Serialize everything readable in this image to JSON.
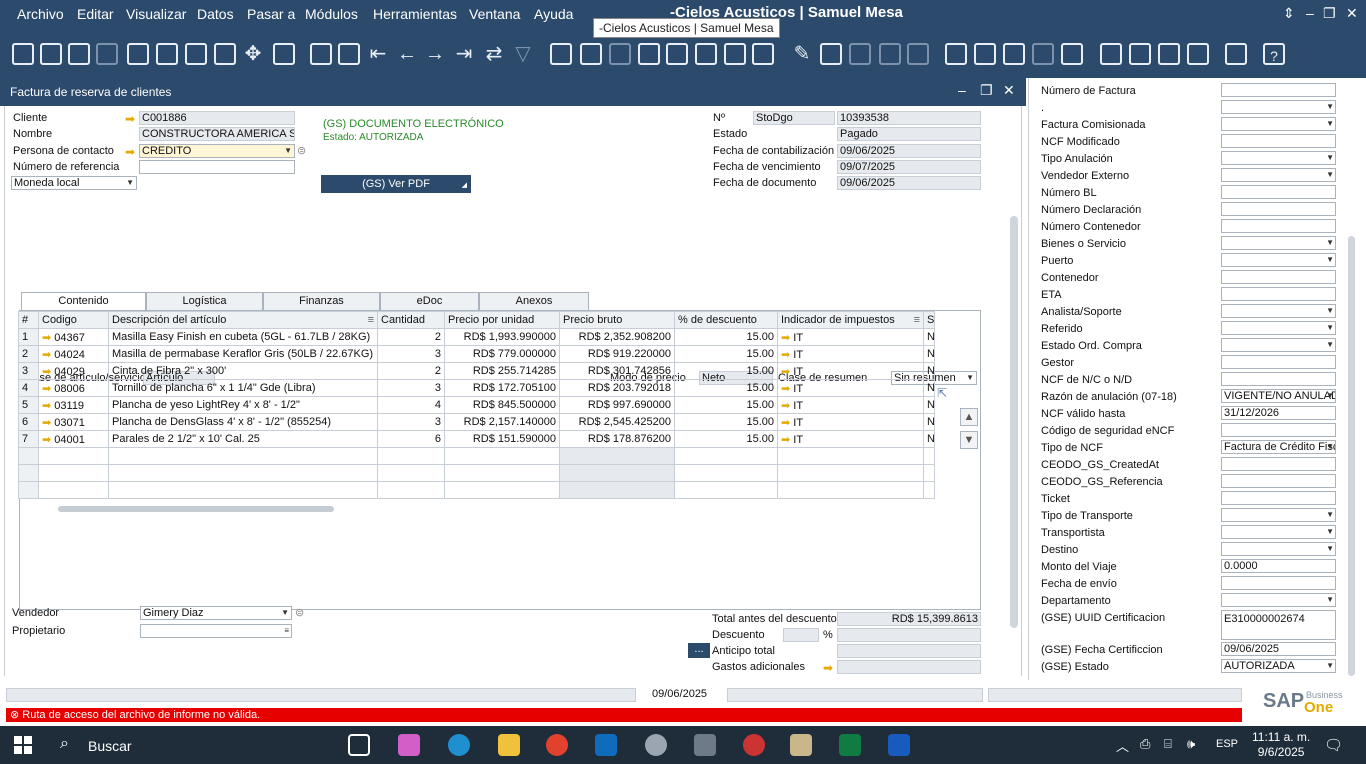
{
  "app": {
    "title": "-Cielos Acusticos | Samuel Mesa",
    "tooltip": "-Cielos Acusticos | Samuel Mesa",
    "menu": [
      "Archivo",
      "Editar",
      "Visualizar",
      "Datos",
      "Pasar a",
      "Módulos",
      "Herramientas",
      "Ventana",
      "Ayuda"
    ]
  },
  "window": {
    "title": "Factura de reserva de clientes"
  },
  "header": {
    "cliente_label": "Cliente",
    "cliente_value": "C001886",
    "nombre_label": "Nombre",
    "nombre_value": "CONSTRUCTORA AMERICA SRL",
    "contacto_label": "Persona de contacto",
    "contacto_value": "CREDITO",
    "referencia_label": "Número de referencia",
    "referencia_value": "",
    "moneda_value": "Moneda local",
    "gs_doc": "(GS) DOCUMENTO ELECTRÓNICO",
    "gs_estado": "Estado: AUTORIZADA",
    "gs_pdf": "(GS) Ver PDF",
    "no_label": "Nº",
    "serie_value": "StoDgo",
    "numero_value": "10393538",
    "estado_label": "Estado",
    "estado_value": "Pagado",
    "fcont_label": "Fecha de contabilización",
    "fcont_value": "09/06/2025",
    "fvenc_label": "Fecha de vencimiento",
    "fvenc_value": "09/07/2025",
    "fdoc_label": "Fecha de documento",
    "fdoc_value": "09/06/2025"
  },
  "tabs": [
    "Contenido",
    "Logística",
    "Finanzas",
    "eDoc",
    "Anexos"
  ],
  "content": {
    "clase_label": "Clase de artículo/servicio",
    "clase_value": "Artículo",
    "modo_label": "Modo de precio",
    "modo_value": "Neto",
    "resumen_label": "Clase de resumen",
    "resumen_value": "Sin resumen"
  },
  "grid": {
    "headers": [
      "#",
      "Codigo",
      "Descripción del artículo",
      "Cantidad",
      "Precio por unidad",
      "Precio bruto",
      "% de descuento",
      "Indicador de impuestos",
      "S"
    ],
    "rows": [
      [
        "1",
        "04367",
        "Masilla Easy Finish en cubeta (5GL - 61.7LB / 28KG)",
        "2",
        "RD$ 1,993.990000",
        "RD$ 2,352.908200",
        "15.00",
        "IT",
        "N"
      ],
      [
        "2",
        "04024",
        "Masilla de permabase Keraflor Gris (50LB / 22.67KG)",
        "3",
        "RD$ 779.000000",
        "RD$ 919.220000",
        "15.00",
        "IT",
        "N"
      ],
      [
        "3",
        "04029",
        "Cinta de Fibra  2\" x 300'",
        "2",
        "RD$ 255.714285",
        "RD$ 301.742856",
        "15.00",
        "IT",
        "N"
      ],
      [
        "4",
        "08006",
        "Tornillo de plancha 6\" x 1 1/4\" Gde (Libra)",
        "3",
        "RD$ 172.705100",
        "RD$ 203.792018",
        "15.00",
        "IT",
        "N"
      ],
      [
        "5",
        "03119",
        "Plancha de yeso LightRey 4' x 8' - 1/2\"",
        "4",
        "RD$ 845.500000",
        "RD$ 997.690000",
        "15.00",
        "IT",
        "N"
      ],
      [
        "6",
        "03071",
        "Plancha de DensGlass 4' x 8' - 1/2\" (855254)",
        "3",
        "RD$ 2,157.140000",
        "RD$ 2,545.425200",
        "15.00",
        "IT",
        "N"
      ],
      [
        "7",
        "04001",
        "Parales de 2 1/2\" x 10' Cal. 25",
        "6",
        "RD$ 151.590000",
        "RD$ 178.876200",
        "15.00",
        "IT",
        "N"
      ]
    ]
  },
  "footer": {
    "vendedor_label": "Vendedor",
    "vendedor_value": "Gimery Diaz",
    "propietario_label": "Propietario",
    "total_label": "Total antes del descuento",
    "total_value": "RD$ 15,399.8613",
    "descuento_label": "Descuento",
    "pct": "%",
    "anticipo_label": "Anticipo total",
    "gastos_label": "Gastos adicionales",
    "ellipsis": "..."
  },
  "status": {
    "date": "09/06/2025",
    "error": "Ruta de acceso del archivo de informe no válida.",
    "sap": "SAP",
    "business": "Business",
    "one": "One"
  },
  "udf": [
    {
      "label": "Número de Factura",
      "value": "",
      "dd": false
    },
    {
      "label": ".",
      "value": "",
      "dd": true
    },
    {
      "label": "Factura Comisionada",
      "value": "",
      "dd": true
    },
    {
      "label": "NCF Modificado",
      "value": "",
      "dd": false
    },
    {
      "label": "Tipo Anulación",
      "value": "",
      "dd": true
    },
    {
      "label": "Vendedor Externo",
      "value": "",
      "dd": true
    },
    {
      "label": "Número BL",
      "value": "",
      "dd": false
    },
    {
      "label": "Número Declaración",
      "value": "",
      "dd": false
    },
    {
      "label": "Número Contenedor",
      "value": "",
      "dd": false
    },
    {
      "label": "Bienes o Servicio",
      "value": "",
      "dd": true
    },
    {
      "label": "Puerto",
      "value": "",
      "dd": true
    },
    {
      "label": "Contenedor",
      "value": "",
      "dd": false
    },
    {
      "label": "ETA",
      "value": "",
      "dd": false
    },
    {
      "label": "Analista/Soporte",
      "value": "",
      "dd": true
    },
    {
      "label": "Referido",
      "value": "",
      "dd": true
    },
    {
      "label": "Estado Ord. Compra",
      "value": "",
      "dd": true
    },
    {
      "label": "Gestor",
      "value": "",
      "dd": false
    },
    {
      "label": "NCF de N/C o N/D",
      "value": "",
      "dd": false
    },
    {
      "label": "Razón de anulación (07-18)",
      "value": "VIGENTE/NO ANULADO",
      "dd": true
    },
    {
      "label": "NCF válido hasta",
      "value": "31/12/2026",
      "dd": false
    },
    {
      "label": "Código de seguridad eNCF",
      "value": "",
      "dd": false
    },
    {
      "label": "Tipo de NCF",
      "value": "Factura de Crédito Fiscal",
      "dd": true
    },
    {
      "label": "CEODO_GS_CreatedAt",
      "value": "",
      "dd": false
    },
    {
      "label": "CEODO_GS_Referencia",
      "value": "",
      "dd": false
    },
    {
      "label": "Ticket",
      "value": "",
      "dd": false
    },
    {
      "label": "Tipo de Transporte",
      "value": "",
      "dd": true
    },
    {
      "label": "Transportista",
      "value": "",
      "dd": true
    },
    {
      "label": "Destino",
      "value": "",
      "dd": true
    },
    {
      "label": "Monto del Viaje",
      "value": "0.0000",
      "dd": false
    },
    {
      "label": "Fecha de envío",
      "value": "",
      "dd": false
    },
    {
      "label": "Departamento",
      "value": "",
      "dd": true
    },
    {
      "label": "(GSE) UUID Certificacion",
      "value": "E310000002674",
      "dd": false
    },
    {
      "label": "(GSE) Fecha Certificcion",
      "value": "09/06/2025",
      "dd": false
    },
    {
      "label": "(GSE) Estado",
      "value": "AUTORIZADA",
      "dd": true
    }
  ],
  "taskbar": {
    "search": "Buscar",
    "lang": "ESP",
    "time": "11:11 a. m.",
    "date": "9/6/2025"
  }
}
